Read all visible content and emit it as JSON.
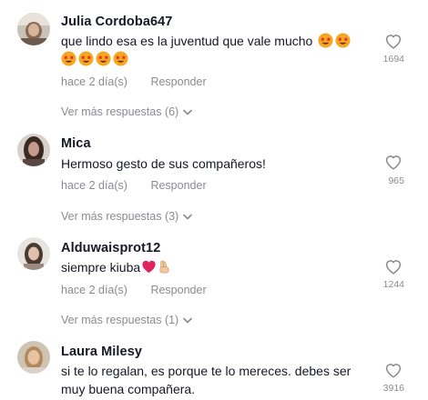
{
  "comments": [
    {
      "username": "Julia Cordoba647",
      "text_line1": "que lindo esa es la juventud que vale mucho",
      "time": "hace 2 día(s)",
      "reply_label": "Responder",
      "like_count": "1694",
      "more_replies": "Ver más respuestas (6)"
    },
    {
      "username": "Mica",
      "text_line1": "Hermoso gesto de sus compañeros!",
      "time": "hace 2 día(s)",
      "reply_label": "Responder",
      "like_count": "965",
      "more_replies": "Ver más respuestas (3)"
    },
    {
      "username": "Alduwaisprot12",
      "text_line1": "siempre kiuba",
      "time": "hace 2 día(s)",
      "reply_label": "Responder",
      "like_count": "1244",
      "more_replies": "Ver más respuestas (1)"
    },
    {
      "username": "Laura Milesy",
      "text_line1": "si te lo regalan, es porque te lo mereces. debes ser",
      "text_line2": "muy buena compañera.",
      "like_count": "3916"
    }
  ],
  "icons": {
    "like": "heart-outline-icon",
    "expand": "chevron-down-icon",
    "emoji_star_eyes": "star-struck-emoji",
    "emoji_heart": "red-heart-emoji",
    "emoji_hand": "crossed-fingers-emoji"
  },
  "colors": {
    "text": "#161823",
    "muted": "#8a8b91",
    "heart_emoji": "#e0245e",
    "star_emoji": "#f5a623"
  }
}
